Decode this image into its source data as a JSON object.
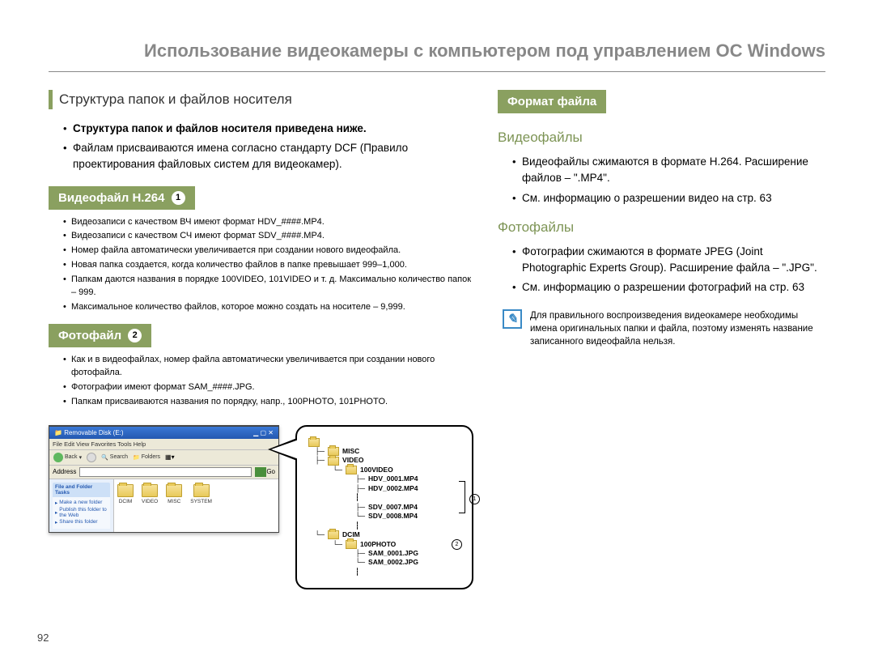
{
  "main_title": "Использование видеокамеры с компьютером под управлением ОС Windows",
  "page_number": "92",
  "left": {
    "heading": "Структура папок и файлов носителя",
    "intro": [
      "Структура папок и файлов носителя приведена ниже.",
      "Файлам присваиваются имена согласно стандарту DCF (Правило проектирования файловых систем для видеокамер)."
    ],
    "video_tag": "Видеофайл H.264",
    "video_tag_num": "1",
    "video_items": [
      "Видеозаписи с качеством ВЧ имеют формат HDV_####.MP4.",
      "Видеозаписи с качеством СЧ имеют формат SDV_####.MP4.",
      "Номер файла автоматически увеличивается при создании нового видеофайла.",
      "Новая папка создается, когда количество файлов в папке превышает 999–1,000.",
      "Папкам даются названия в порядке 100VIDEO, 101VIDEO и т. д. Максимально количество папок – 999.",
      "Максимальное количество файлов, которое можно создать на носителе – 9,999."
    ],
    "photo_tag": "Фотофайл",
    "photo_tag_num": "2",
    "photo_items": [
      "Как и в видеофайлах, номер файла автоматически увеличивается при создании нового фотофайла.",
      "Фотографии имеют формат SAM_####.JPG.",
      "Папкам присваиваются названия по порядку, напр., 100PHOTO, 101PHOTO."
    ]
  },
  "right": {
    "format_tag": "Формат файла",
    "video_sub": "Видеофайлы",
    "video_bullets": [
      "Видеофайлы сжимаются в формате H.264. Расширение файлов – \".MP4\".",
      "См. информацию о разрешении видео на стр. 63"
    ],
    "photo_sub": "Фотофайлы",
    "photo_bullets": [
      "Фотографии сжимаются в формате JPEG (Joint Photographic Experts Group). Расширение файла – \".JPG\".",
      "См. информацию о разрешении фотографий на стр. 63"
    ],
    "note": "Для правильного воспроизведения видеокамере необходимы имена оригинальных папки и файла, поэтому изменять название записанного видеофайла нельзя."
  },
  "explorer": {
    "title": "Removable Disk (E:)",
    "menu": "File   Edit   View   Favorites   Tools   Help",
    "back": "Back",
    "search": "Search",
    "folders_btn": "Folders",
    "address_label": "Address",
    "go": "Go",
    "sidepanel_title": "File and Folder Tasks",
    "side_items": [
      "Make a new folder",
      "Publish this folder to the Web",
      "Share this folder"
    ],
    "folders": [
      "DCIM",
      "VIDEO",
      "MISC",
      "SYSTEM"
    ]
  },
  "tree": {
    "misc": "MISC",
    "video": "VIDEO",
    "v100": "100VIDEO",
    "hdv1": "HDV_0001.MP4",
    "hdv2": "HDV_0002.MP4",
    "sdv7": "SDV_0007.MP4",
    "sdv8": "SDV_0008.MP4",
    "dcim": "DCIM",
    "p100": "100PHOTO",
    "sam1": "SAM_0001.JPG",
    "sam2": "SAM_0002.JPG",
    "marker1": "1",
    "marker2": "2"
  }
}
